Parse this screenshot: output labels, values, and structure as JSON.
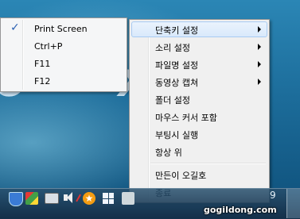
{
  "submenu": {
    "items": [
      {
        "label": "Print Screen",
        "checked": true
      },
      {
        "label": "Ctrl+P",
        "checked": false
      },
      {
        "label": "F11",
        "checked": false
      },
      {
        "label": "F12",
        "checked": false
      }
    ],
    "check_glyph": "✓"
  },
  "menu": {
    "items": [
      {
        "label": "단축키 설정",
        "has_submenu": true,
        "highlighted": true
      },
      {
        "label": "소리 설정",
        "has_submenu": true
      },
      {
        "label": "파일명 설정",
        "has_submenu": true
      },
      {
        "label": "동영상 캡쳐",
        "has_submenu": true
      },
      {
        "label": "폴더 설정"
      },
      {
        "label": "마우스 커서 포함"
      },
      {
        "label": "부팅시 실행"
      },
      {
        "label": "항상 위"
      },
      {
        "label": "만든이 오길호"
      },
      {
        "label": "종료"
      }
    ]
  },
  "taskbar": {
    "clock_partial": "9",
    "star_glyph": "★",
    "icons": [
      "shield-icon",
      "color-app-icon",
      "monitor-icon",
      "speaker-muted-icon",
      "star-app-icon",
      "windows-flag-icon",
      "pointer-app-icon"
    ]
  },
  "watermark": "gogildong.com",
  "colors": {
    "highlight_bg": "#d9e9fb",
    "highlight_border": "#a8caf2",
    "check_color": "#2c62b3",
    "menu_bg": "#f0f0f0"
  }
}
